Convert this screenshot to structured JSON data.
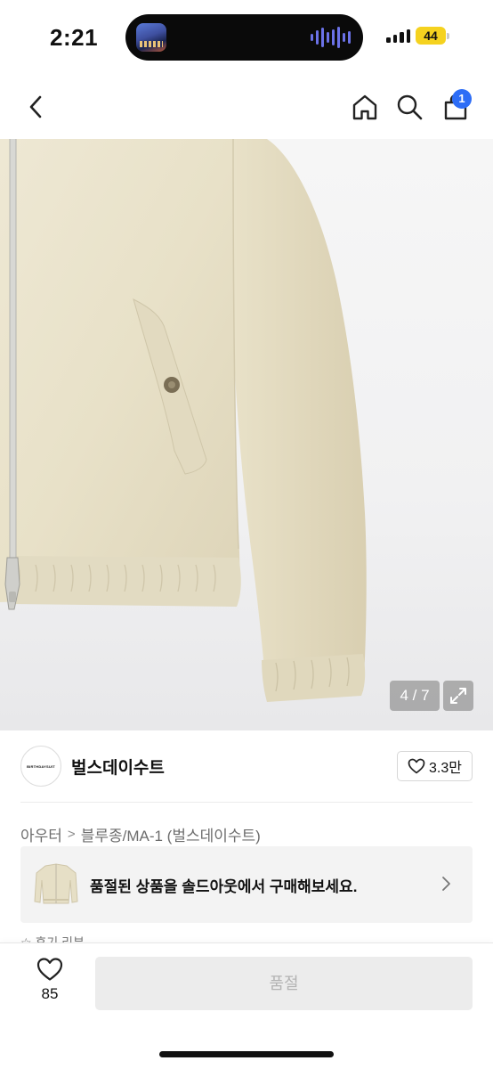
{
  "status_bar": {
    "time": "2:21",
    "battery": "44",
    "battery_color": "#f5d21f"
  },
  "nav": {
    "back_icon": "chevron-left-icon",
    "home_icon": "home-icon",
    "search_icon": "search-icon",
    "cart_icon": "shopping-bag-icon",
    "cart_badge": "1",
    "badge_color": "#2d6df6"
  },
  "gallery": {
    "counter": "4 / 7",
    "expand_icon": "expand-icon"
  },
  "brand": {
    "logo_text": "BIRTHDAYSUIT",
    "name": "벌스데이수트",
    "follow_icon": "heart-outline-icon",
    "follow_count": "3.3만"
  },
  "breadcrumb": {
    "items": [
      "아우터",
      "블루종/MA-1 (벌스데이수트)"
    ],
    "separator": ">"
  },
  "soldout_banner": {
    "text": "품절된 상품을 솔드아웃에서 구매해보세요.",
    "chevron_icon": "chevron-right-icon"
  },
  "peek_text": "☆ 후기 리뷰",
  "bottom_bar": {
    "wish_icon": "heart-outline-icon",
    "wish_count": "85",
    "action_label": "품절"
  }
}
